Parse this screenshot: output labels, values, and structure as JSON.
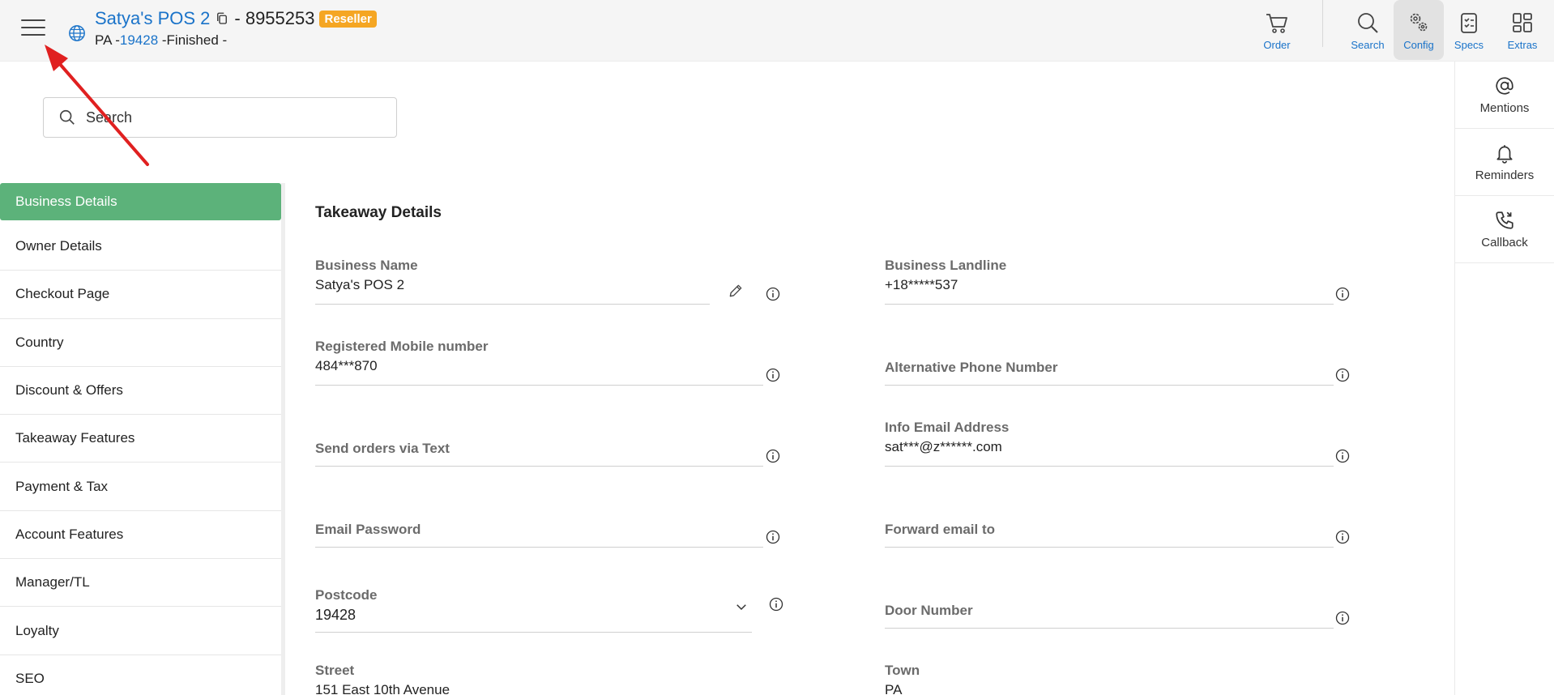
{
  "header": {
    "shop_name": "Satya's POS 2",
    "shop_id": "- 8955253",
    "badge": "Reseller",
    "sub_prefix": "PA -",
    "sub_zip": "19428",
    "sub_suffix": " -Finished -",
    "buttons": {
      "order": "Order",
      "search": "Search",
      "config": "Config",
      "specs": "Specs",
      "extras": "Extras"
    }
  },
  "rail": {
    "mentions": "Mentions",
    "reminders": "Reminders",
    "callback": "Callback"
  },
  "search": {
    "placeholder": "Search"
  },
  "sidebar": {
    "items": [
      {
        "label": "Business Details"
      },
      {
        "label": "Owner Details"
      },
      {
        "label": "Checkout Page"
      },
      {
        "label": "Country"
      },
      {
        "label": "Discount & Offers"
      },
      {
        "label": "Takeaway Features"
      },
      {
        "label": "Payment & Tax"
      },
      {
        "label": "Account Features"
      },
      {
        "label": "Manager/TL"
      },
      {
        "label": "Loyalty"
      },
      {
        "label": "SEO"
      }
    ]
  },
  "form": {
    "section_title": "Takeaway Details",
    "business_name": {
      "label": "Business Name",
      "value": "Satya's POS 2"
    },
    "business_landline": {
      "label": "Business Landline",
      "value": "+18*****537"
    },
    "registered_mobile": {
      "label": "Registered Mobile number",
      "value": "484***870"
    },
    "alternative_phone": {
      "label": "Alternative Phone Number",
      "value": ""
    },
    "send_orders_text": {
      "label": "Send orders via Text",
      "value": ""
    },
    "info_email": {
      "label": "Info Email Address",
      "value": "sat***@z******.com"
    },
    "email_password": {
      "label": "Email Password",
      "value": ""
    },
    "forward_email": {
      "label": "Forward email to",
      "value": ""
    },
    "postcode": {
      "label": "Postcode",
      "value": "19428"
    },
    "door_number": {
      "label": "Door Number",
      "value": ""
    },
    "street": {
      "label": "Street",
      "value": "151 East 10th Avenue"
    },
    "town": {
      "label": "Town",
      "value": "PA"
    }
  },
  "colors": {
    "accent_blue": "#1a73c9",
    "active_green": "#5cb27a",
    "badge_orange": "#f5a623",
    "annotation_red": "#e02020"
  }
}
